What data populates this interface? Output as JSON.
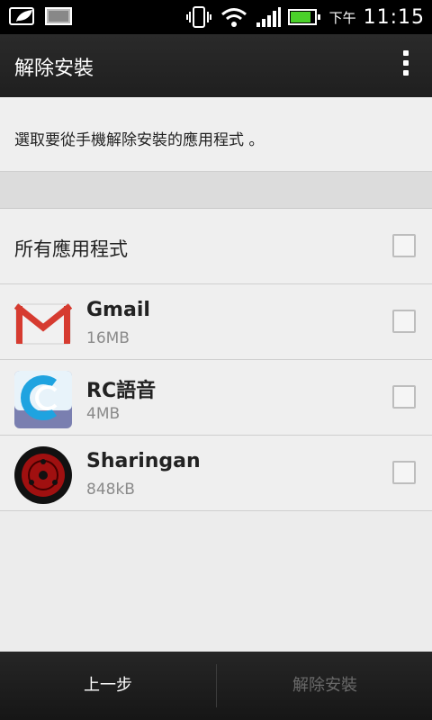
{
  "status_bar": {
    "ampm": "下午",
    "time": "11:15",
    "battery_level": 0.85,
    "battery_color": "#4bd12a"
  },
  "action_bar": {
    "title": "解除安裝",
    "menu_icon": "overflow-menu-icon"
  },
  "instruction": "選取要從手機解除安裝的應用程式 。",
  "select_all_label": "所有應用程式",
  "apps": [
    {
      "name": "Gmail",
      "size": "16MB",
      "icon": "gmail-icon"
    },
    {
      "name": "RC語音",
      "size": "4MB",
      "icon": "rc-voice-icon"
    },
    {
      "name": "Sharingan",
      "size": "848kB",
      "icon": "sharingan-icon"
    }
  ],
  "bottom_bar": {
    "back_label": "上一步",
    "uninstall_label": "解除安裝"
  }
}
